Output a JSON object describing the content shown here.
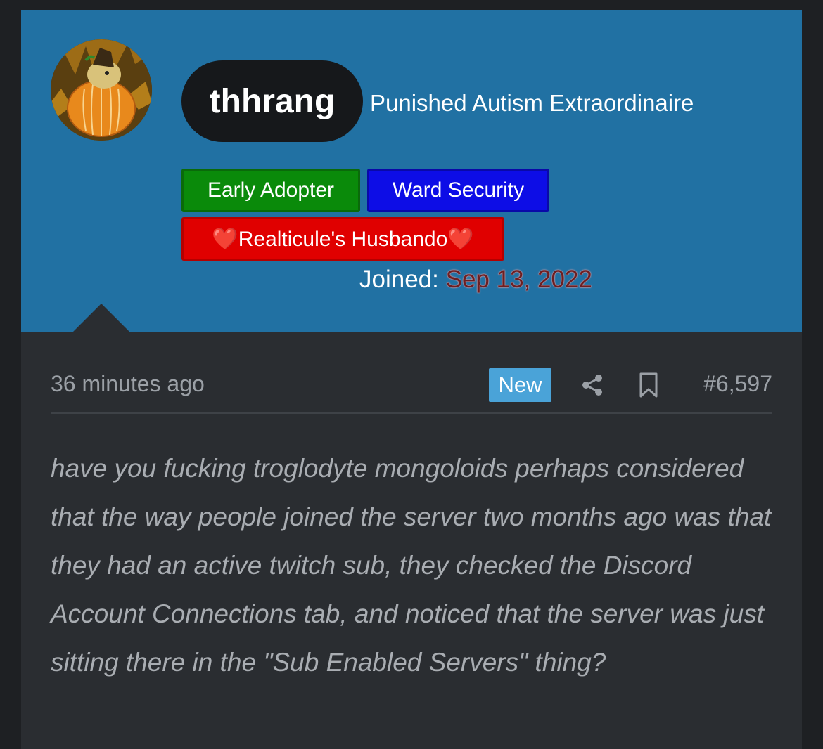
{
  "user": {
    "username": "thhrang",
    "title": "Punished Autism Extraordinaire",
    "banners": [
      {
        "label": "Early Adopter",
        "color": "#0a8a0a"
      },
      {
        "label": "Ward Security",
        "color": "#0d0de6"
      },
      {
        "label": "❤️Realticule's Husbando❤️",
        "color": "#e00000"
      }
    ],
    "joined_label": "Joined:",
    "joined_date": "Sep 13, 2022"
  },
  "post": {
    "timestamp": "36 minutes ago",
    "badge": "New",
    "number": "#6,597",
    "message": "have you fucking troglodyte mongoloids perhaps considered that the way people joined the server two months ago was that they had an active twitch sub, they checked the Discord Account Connections tab, and noticed that the server was just sitting there in the \"Sub Enabled Servers\" thing?"
  },
  "icons": {
    "share": "share-icon",
    "bookmark": "bookmark-icon"
  },
  "colors": {
    "header_bg": "#2171a3",
    "card_bg": "#2a2d31",
    "page_bg": "#1e2023",
    "new_badge": "#4aa3d8"
  }
}
